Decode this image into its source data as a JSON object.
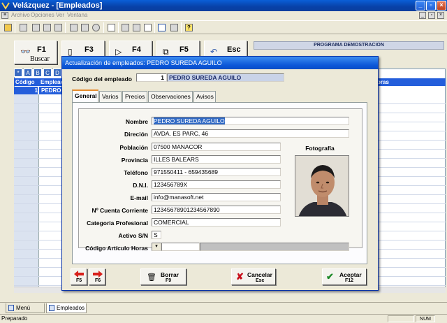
{
  "window": {
    "title": "Velázquez - [Empleados]"
  },
  "menu": [
    "Archivo",
    "Opciones",
    "Ver",
    "Ventana"
  ],
  "fkeys": [
    {
      "key": "F1",
      "label": "Buscar"
    },
    {
      "key": "F3",
      "label": ""
    },
    {
      "key": "F4",
      "label": ""
    },
    {
      "key": "F5",
      "label": ""
    },
    {
      "key": "Esc",
      "label": ""
    }
  ],
  "banner": "PROGRAMA DEMOSTRACION",
  "grid": {
    "letters": [
      "*",
      "A",
      "B",
      "C",
      "D"
    ],
    "headers": {
      "codigo": "Código",
      "empleado": "Emplead",
      "right": "oras"
    },
    "row": {
      "num": "1",
      "name": "PEDRO S"
    }
  },
  "dialog": {
    "title": "Actualización de empleados: PEDRO SUREDA AGUILO",
    "code_label": "Código del empleado",
    "code_value": "1",
    "code_name": "PEDRO SUREDA AGUILO",
    "tabs": [
      "General",
      "Varios",
      "Precios",
      "Observaciones",
      "Avisos"
    ],
    "fields": {
      "nombre": {
        "label": "Nombre",
        "value": "PEDRO SUREDA AGUILO"
      },
      "direccion": {
        "label": "Direción",
        "value": "AVDA. ES PARC, 46"
      },
      "poblacion": {
        "label": "Población",
        "value": "07500 MANACOR"
      },
      "provincia": {
        "label": "Provincia",
        "value": "ILLES BALEARS"
      },
      "telefono": {
        "label": "Teléfono",
        "value": "971550411 - 659435689"
      },
      "dni": {
        "label": "D.N.I.",
        "value": "123456789X"
      },
      "email": {
        "label": "E-mail",
        "value": "info@manasoft.net"
      },
      "cuenta": {
        "label": "Nº Cuenta Corriente",
        "value": "12345678901234567890"
      },
      "categoria": {
        "label": "Categoria Profesional",
        "value": "COMERCIAL"
      },
      "activo": {
        "label": "Activo S/N",
        "value": "S"
      },
      "articulo": {
        "label": "Código Artículo Horas",
        "value": ""
      }
    },
    "photo_label": "Fotografía",
    "buttons": {
      "prev": "F5",
      "next": "F6",
      "borrar": {
        "label": "Borrar",
        "key": "F9"
      },
      "cancelar": {
        "label": "Cancelar",
        "key": "Esc"
      },
      "aceptar": {
        "label": "Aceptar",
        "key": "F12"
      }
    }
  },
  "bottom_tabs": [
    "Menú inicial",
    "Empleados"
  ],
  "status": {
    "text": "Preparado",
    "num": "NUM"
  }
}
